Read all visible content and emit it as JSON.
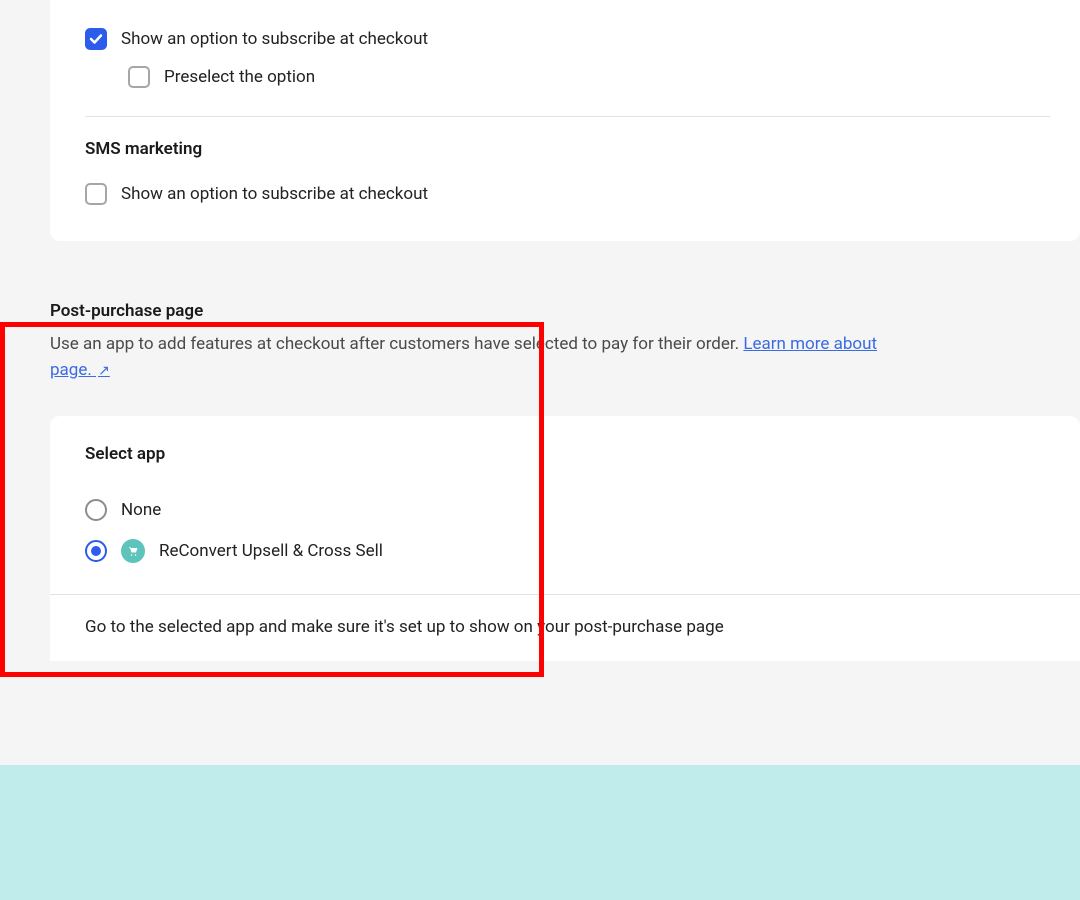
{
  "email_marketing": {
    "show_subscribe_label": "Show an option to subscribe at checkout",
    "show_subscribe_checked": true,
    "preselect_label": "Preselect the option",
    "preselect_checked": false
  },
  "sms_marketing": {
    "heading": "SMS marketing",
    "show_subscribe_label": "Show an option to subscribe at checkout",
    "show_subscribe_checked": false
  },
  "post_purchase": {
    "title": "Post-purchase page",
    "desc_prefix": "Use an app to add features at checkout after customers have selected to pay for their order. ",
    "link_text_a": "Learn more about",
    "link_text_b": "page.",
    "select_app_heading": "Select app",
    "options": {
      "none": {
        "label": "None",
        "selected": false
      },
      "reconvert": {
        "label": "ReConvert Upsell & Cross Sell",
        "selected": true,
        "icon": "cart-icon"
      }
    },
    "hint": "Go to the selected app and make sure it's set up to show on your post-purchase page"
  }
}
